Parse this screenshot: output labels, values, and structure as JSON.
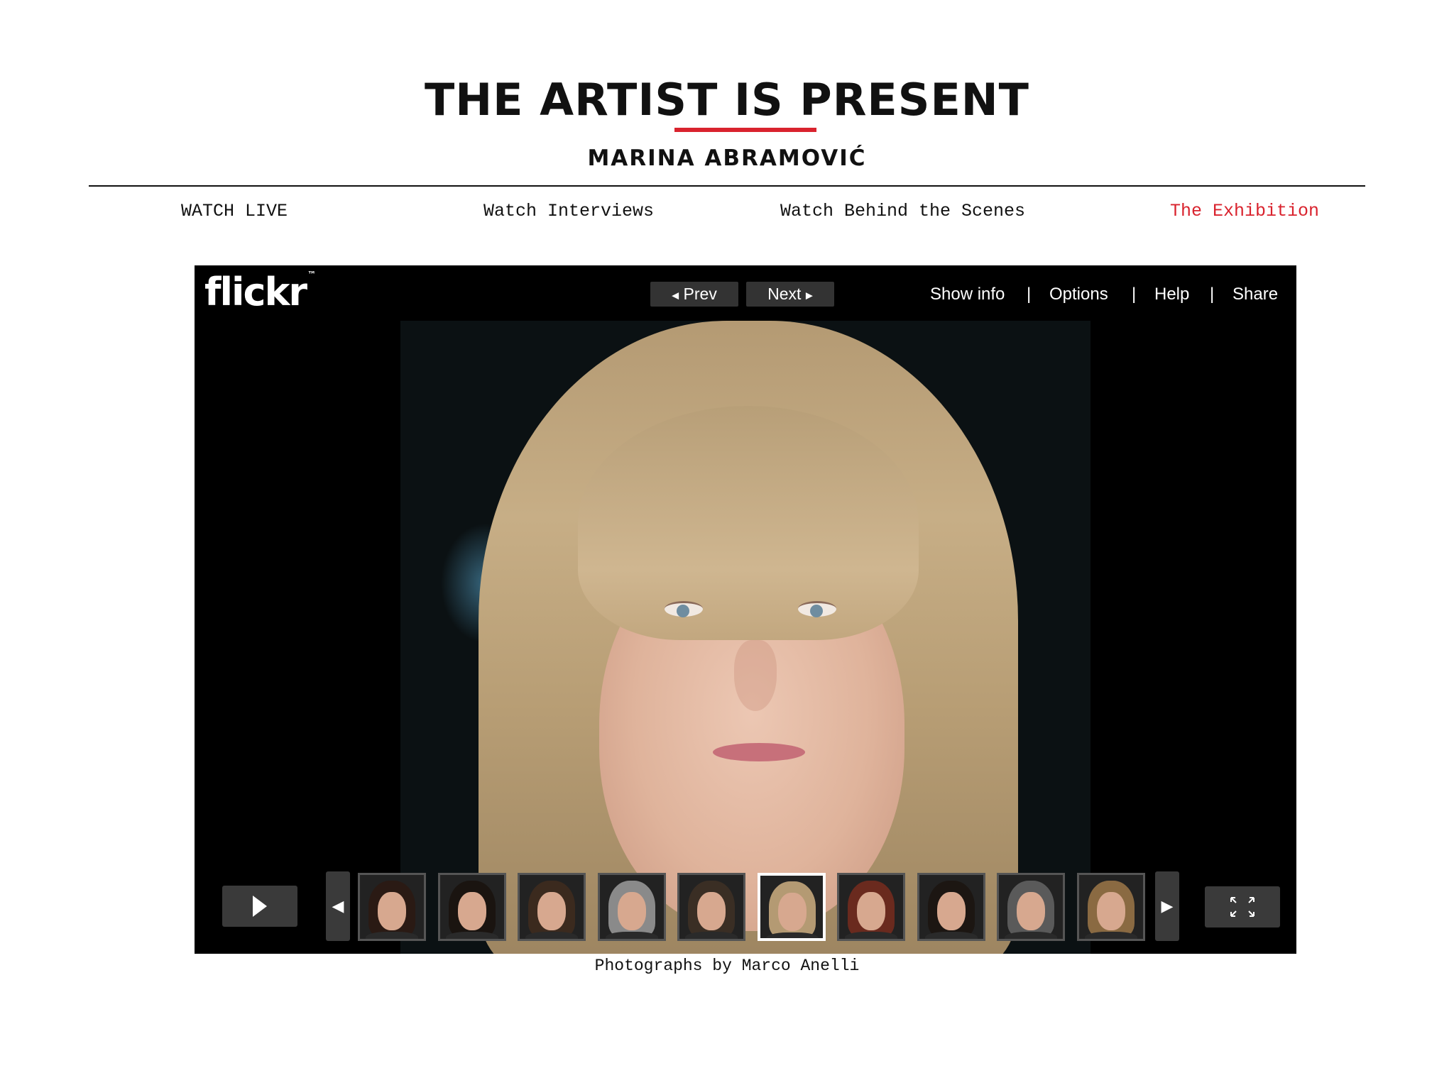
{
  "header": {
    "title": "THE ARTIST IS PRESENT",
    "subtitle": "MARINA ABRAMOVIĆ",
    "accent_color": "#d9232e"
  },
  "nav": {
    "items": [
      {
        "label": "WATCH LIVE",
        "active": false
      },
      {
        "label": "Watch Interviews",
        "active": false
      },
      {
        "label": "Watch Behind the Scenes",
        "active": false
      },
      {
        "label": "The Exhibition",
        "active": true
      }
    ]
  },
  "viewer": {
    "logo": "flickr",
    "prev_label": "Prev",
    "next_label": "Next",
    "links": [
      "Show info",
      "Options",
      "Help",
      "Share"
    ],
    "separator": "|",
    "thumbnails": [
      {
        "icon": "portrait-thumbnail",
        "selected": false,
        "hair": "#2a1a14"
      },
      {
        "icon": "portrait-thumbnail",
        "selected": false,
        "hair": "#1a1410"
      },
      {
        "icon": "portrait-thumbnail",
        "selected": false,
        "hair": "#3b2a1e"
      },
      {
        "icon": "portrait-thumbnail",
        "selected": false,
        "hair": "#8a8a8a"
      },
      {
        "icon": "portrait-thumbnail",
        "selected": false,
        "hair": "#3a2e24"
      },
      {
        "icon": "portrait-thumbnail",
        "selected": true,
        "hair": "#b49a73"
      },
      {
        "icon": "portrait-thumbnail",
        "selected": false,
        "hair": "#6a2a1e"
      },
      {
        "icon": "portrait-thumbnail",
        "selected": false,
        "hair": "#1c1612"
      },
      {
        "icon": "portrait-thumbnail",
        "selected": false,
        "hair": "#5a5a5a"
      },
      {
        "icon": "portrait-thumbnail",
        "selected": false,
        "hair": "#8a6a42"
      }
    ],
    "play_icon": "play-icon",
    "fullscreen_icon": "fullscreen-icon"
  },
  "caption": "Photographs by Marco Anelli"
}
